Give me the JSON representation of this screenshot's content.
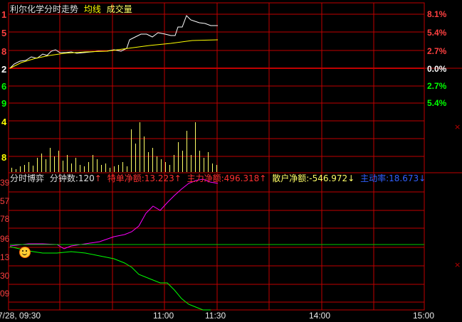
{
  "header": {
    "title": "利尔化学分时走势",
    "avg_label": "均线",
    "vol_label": "成交量"
  },
  "right_axis": {
    "upper": [
      "8.1%",
      "5.4%",
      "2.7%"
    ],
    "zero": "0.0%",
    "lower": [
      "2.7%",
      "5.4%"
    ]
  },
  "left_axis": {
    "price_upper": [
      "1",
      "5",
      "8"
    ],
    "price_zero": "2",
    "price_lower": [
      "6",
      "9"
    ],
    "volume": [
      "4",
      "8"
    ],
    "bottom_panel": [
      "39",
      "57",
      "78",
      "96",
      "13",
      "30",
      "09"
    ]
  },
  "indicator_bar": {
    "name": "分时博弈",
    "count_label": "分钟数:",
    "count_value": "120",
    "big_label": "特单净额:",
    "big_value": "13.223",
    "main_label": "主力净额:",
    "main_value": "496.318",
    "retail_label": "散户净额:",
    "retail_value": "-546.972",
    "ratio_label": "主动率:",
    "ratio_value": "18.673"
  },
  "time_axis": {
    "start": "7/28, 09:30",
    "ticks": [
      "11:00",
      "11:30",
      "14:00",
      "15:00"
    ]
  },
  "colors": {
    "grid": "#c00000",
    "price_line": "#ffffff",
    "avg_line": "#ffff00",
    "volume": "#ffff66",
    "main_flow": "#ff00ff",
    "retail_flow": "#00ff00",
    "baseline": "#00cc00",
    "up_text": "#ff4040",
    "down_text": "#00ff00",
    "title_text": "#e0e0e0"
  }
}
